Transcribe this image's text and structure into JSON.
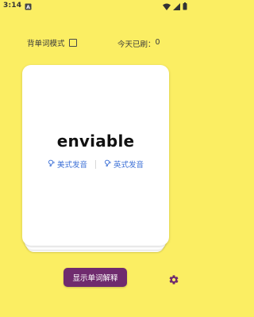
{
  "status_bar": {
    "time": "3:14"
  },
  "controls": {
    "memorize_mode_label": "背单词模式",
    "today_count_label": "今天已刷：",
    "today_count_value": "0"
  },
  "card": {
    "word": "enviable",
    "us_pron_label": "美式发音",
    "uk_pron_label": "英式发音"
  },
  "actions": {
    "show_definition_label": "显示单词解释"
  },
  "colors": {
    "background": "#fbee63",
    "button": "#6f2b6e",
    "pron_link": "#3b6fd6",
    "settings_icon": "#6f2b6e"
  }
}
